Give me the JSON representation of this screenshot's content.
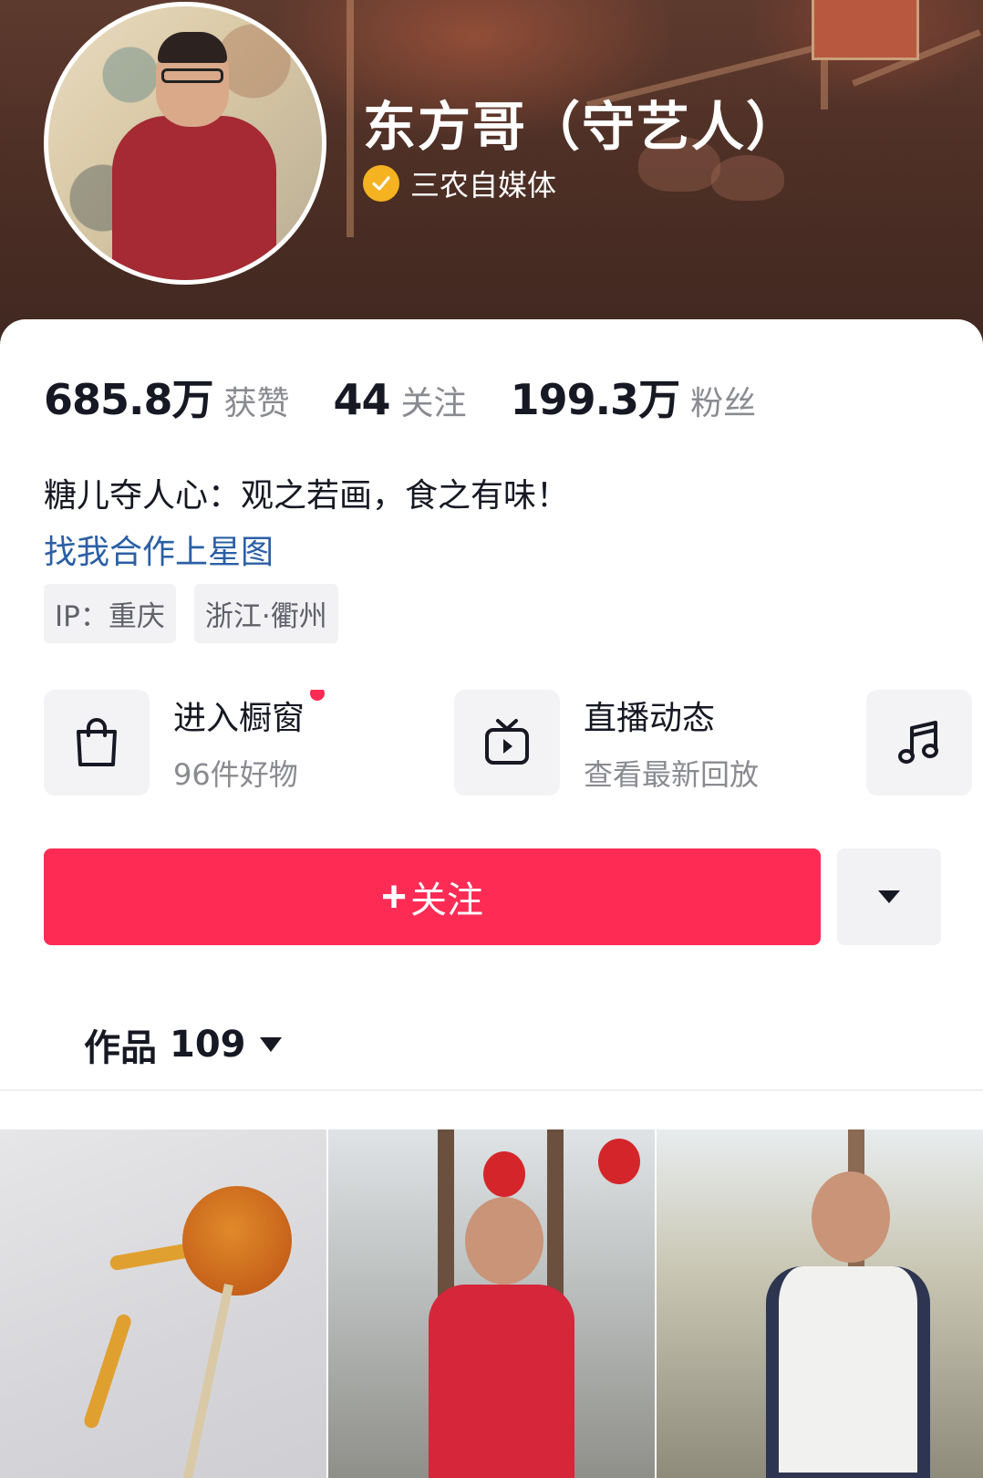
{
  "profile": {
    "name": "东方哥（守艺人）",
    "verification_label": "三农自媒体"
  },
  "stats": [
    {
      "value": "685.8万",
      "label": "获赞"
    },
    {
      "value": "44",
      "label": "关注"
    },
    {
      "value": "199.3万",
      "label": "粉丝"
    }
  ],
  "bio": {
    "text": "糖儿夺人心：观之若画，食之有味！",
    "link": "找我合作上星图"
  },
  "tags": [
    "IP：重庆",
    "浙江·衢州"
  ],
  "features": [
    {
      "title": "进入橱窗",
      "subtitle": "96件好物",
      "icon": "shopping-bag-icon",
      "has_dot": true
    },
    {
      "title": "直播动态",
      "subtitle": "查看最新回放",
      "icon": "tv-play-icon",
      "has_dot": false
    },
    {
      "title": "",
      "subtitle": "",
      "icon": "music-note-icon",
      "has_dot": false
    }
  ],
  "actions": {
    "follow_label": "关注",
    "more_icon": "triangle-down-icon"
  },
  "works_tab": {
    "label": "作品",
    "count": "109"
  },
  "colors": {
    "accent": "#fe2c55",
    "link": "#2b5fa6",
    "verify": "#f5b322",
    "banner": "#4d2f25"
  }
}
